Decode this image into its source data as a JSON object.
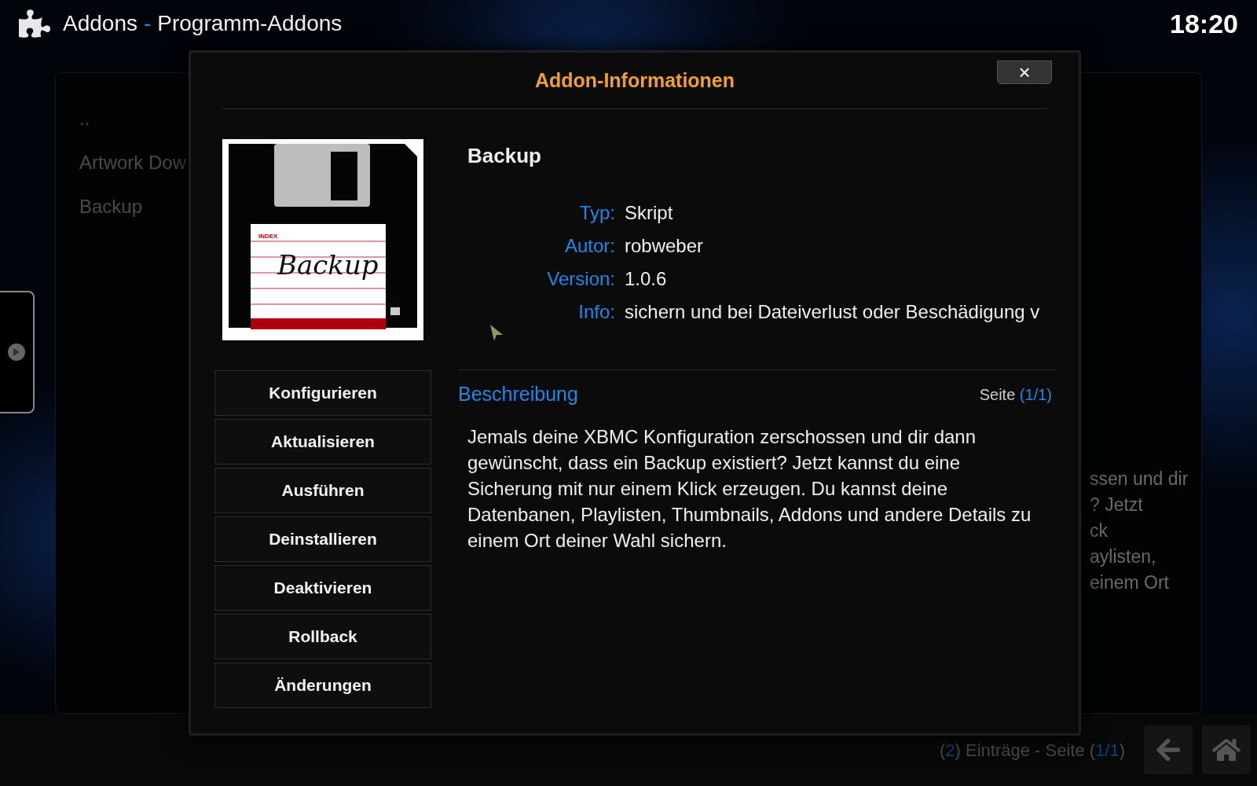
{
  "header": {
    "section": "Addons",
    "separator": "-",
    "subsection": "Programm-Addons",
    "time": "18:20"
  },
  "background_list": {
    "items": [
      "..",
      "Artwork Dow",
      "Backup"
    ],
    "description_fragments": [
      "ssen und dir",
      "? Jetzt",
      "ck",
      "aylisten,",
      "einem Ort"
    ]
  },
  "footer": {
    "open": "(",
    "count": "2",
    "close": ")",
    "label": "Einträge - Seite",
    "page_open": "(",
    "page": "1/1",
    "page_close": ")"
  },
  "dialog": {
    "title": "Addon-Informationen",
    "close": "×",
    "icon": {
      "index_label": "INDEX",
      "handwriting": "Backup"
    },
    "name": "Backup",
    "fields": [
      {
        "label": "Typ:",
        "value": "Skript"
      },
      {
        "label": "Autor:",
        "value": "robweber"
      },
      {
        "label": "Version:",
        "value": "1.0.6"
      },
      {
        "label": "Info:",
        "value": "sichern und bei Dateiverlust oder Beschädigung v"
      }
    ],
    "buttons": [
      "Konfigurieren",
      "Aktualisieren",
      "Ausführen",
      "Deinstallieren",
      "Deaktivieren",
      "Rollback",
      "Änderungen"
    ],
    "description_heading": "Beschreibung",
    "page_label": "Seite",
    "page_open": "(",
    "page": "1/1",
    "page_close": ")",
    "description": "Jemals deine XBMC Konfiguration zerschossen und dir dann gewünscht, dass ein Backup existiert? Jetzt kannst du eine Sicherung mit nur einem Klick erzeugen. Du kannst deine Datenbanen, Playlisten, Thumbnails, Addons und andere Details zu einem Ort deiner Wahl sichern."
  }
}
